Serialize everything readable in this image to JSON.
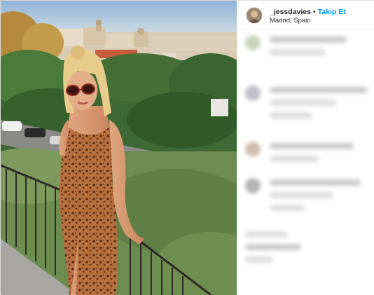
{
  "post": {
    "author": {
      "username": "_jessdavies",
      "separator": "•",
      "follow_label": "Takip Et",
      "location": "Madrid, Spain",
      "avatar_icon": "user-avatar"
    },
    "photo": {
      "subject": "woman in leopard print dress on balcony railing",
      "icon": "photo-image"
    }
  },
  "colors": {
    "follow_blue": "#0095f6",
    "text": "#262626",
    "divider": "#efefef"
  }
}
